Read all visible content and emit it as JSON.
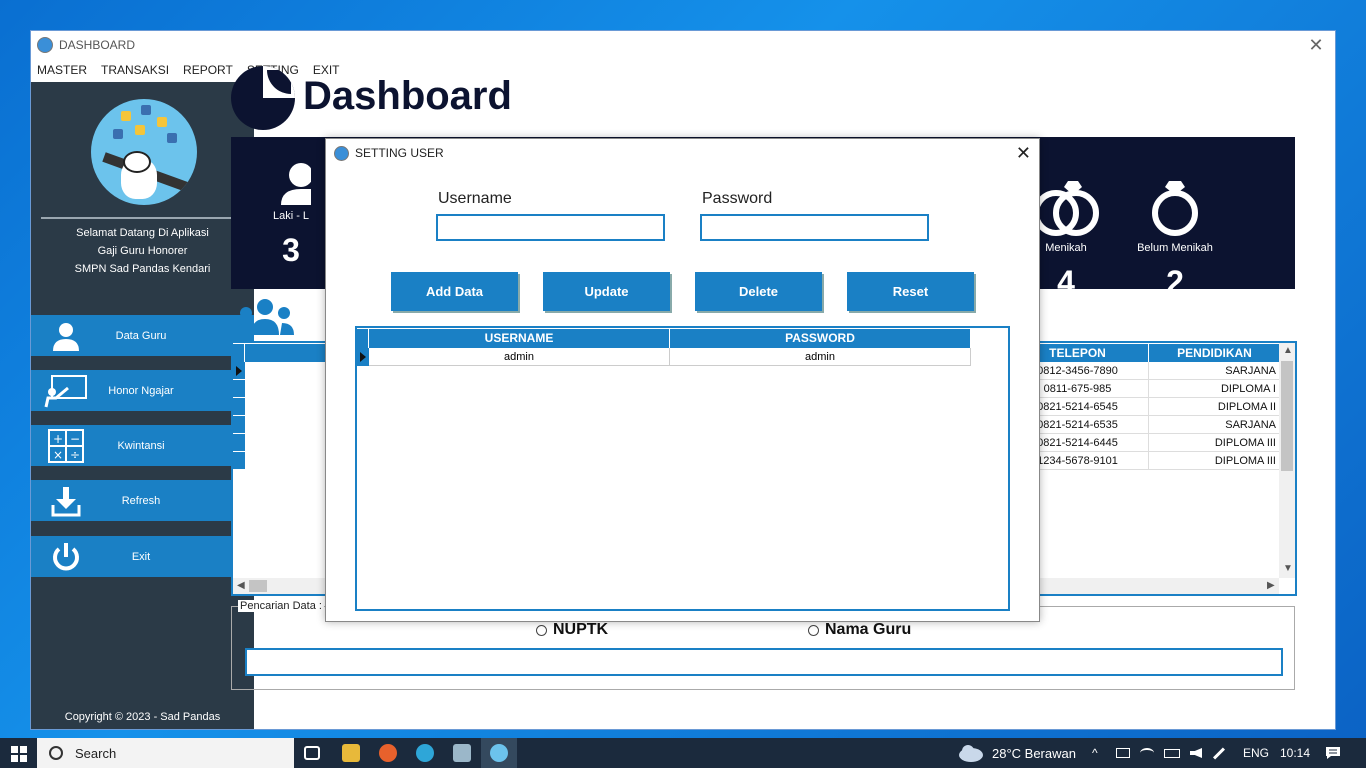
{
  "window": {
    "title": "DASHBOARD",
    "close_glyph": "✕"
  },
  "menu": [
    "MASTER",
    "TRANSAKSI",
    "REPORT",
    "SETTING",
    "EXIT"
  ],
  "sidebar": {
    "welcome": [
      "Selamat Datang Di Aplikasi",
      "Gaji Guru Honorer",
      "SMPN Sad Pandas Kendari"
    ],
    "items": [
      {
        "label": "Data Guru",
        "icon": "user-icon"
      },
      {
        "label": "Honor Ngajar",
        "icon": "teacher-board-icon"
      },
      {
        "label": "Kwintansi",
        "icon": "calculator-icon"
      },
      {
        "label": "Refresh",
        "icon": "download-icon"
      },
      {
        "label": "Exit",
        "icon": "power-icon"
      }
    ],
    "copyright": "Copyright © 2023 - Sad Pandas"
  },
  "dashboard": {
    "title": "Dashboard",
    "stats": [
      {
        "label": "Laki - L",
        "value": "3"
      },
      {
        "label": "Menikah",
        "value": "4"
      },
      {
        "label": "Belum Menikah",
        "value": "2"
      }
    ]
  },
  "grid": {
    "columns": [
      "TELEPON",
      "PENDIDIKAN"
    ],
    "rows": [
      {
        "telepon": "0812-3456-7890",
        "pendidikan": "SARJANA"
      },
      {
        "telepon": "0811-675-985",
        "pendidikan": "DIPLOMA I"
      },
      {
        "telepon": "0821-5214-6545",
        "pendidikan": "DIPLOMA II"
      },
      {
        "telepon": "0821-5214-6535",
        "pendidikan": "SARJANA"
      },
      {
        "telepon": "0821-5214-6445",
        "pendidikan": "DIPLOMA III"
      },
      {
        "telepon": "1234-5678-9101",
        "pendidikan": "DIPLOMA III"
      }
    ]
  },
  "search": {
    "legend": "Pencarian Data :",
    "options": [
      "NUPTK",
      "Nama Guru"
    ],
    "value": ""
  },
  "dialog": {
    "title": "SETTING USER",
    "username_label": "Username",
    "password_label": "Password",
    "username_value": "",
    "password_value": "",
    "buttons": [
      "Add Data",
      "Update",
      "Delete",
      "Reset"
    ],
    "columns": [
      "USERNAME",
      "PASSWORD"
    ],
    "rows": [
      {
        "username": "admin",
        "password": "admin"
      }
    ]
  },
  "taskbar": {
    "search_label": "Search",
    "weather": "28°C  Berawan",
    "lang": "ENG",
    "time": "10:14"
  },
  "colors": {
    "accent": "#1a80c5",
    "sidebar": "#2b3a47",
    "navy": "#0c1330"
  }
}
